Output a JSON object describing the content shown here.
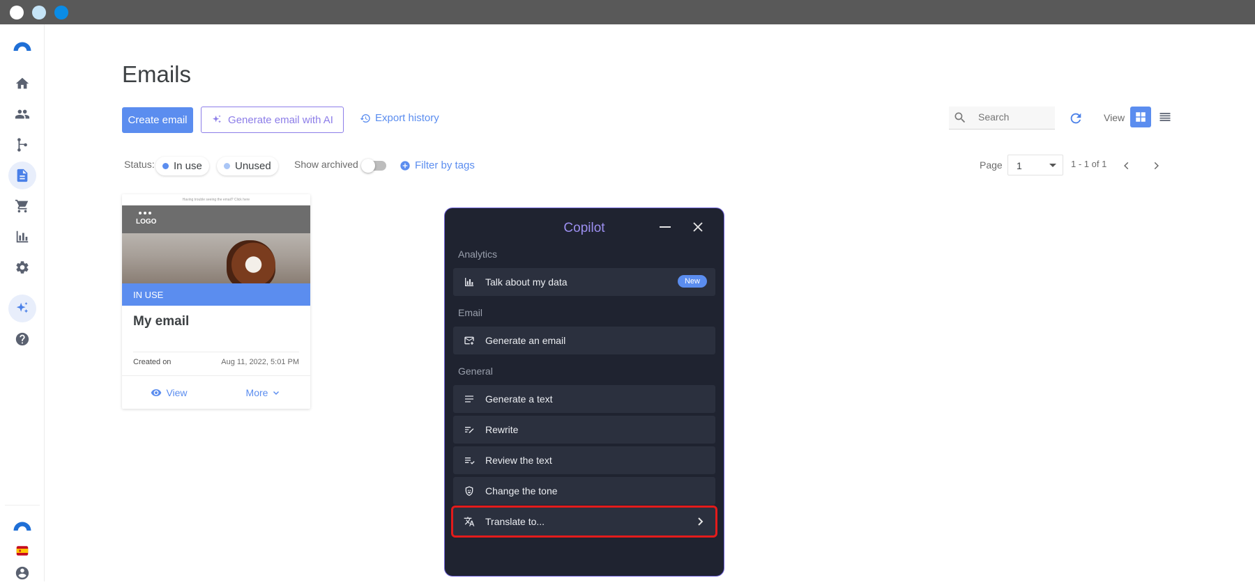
{
  "window": {
    "dots": [
      "#ffffff",
      "#c5e4f7",
      "#0a8ce6"
    ]
  },
  "sidebar": {
    "items": [
      {
        "icon": "home-icon"
      },
      {
        "icon": "contacts-icon"
      },
      {
        "icon": "automation-icon"
      },
      {
        "icon": "document-icon",
        "active": true
      },
      {
        "icon": "cart-icon"
      },
      {
        "icon": "analytics-icon"
      },
      {
        "icon": "settings-icon"
      },
      {
        "icon": "sparkles-icon",
        "active": true
      },
      {
        "icon": "help-icon"
      }
    ]
  },
  "page": {
    "title": "Emails",
    "toolbar": {
      "create_label": "Create email",
      "ai_label": "Generate email with AI",
      "export_label": "Export history",
      "search_placeholder": "Search",
      "view_label": "View"
    },
    "filters": {
      "status_label": "Status:",
      "chips": [
        {
          "label": "In use",
          "color": "#5b8def"
        },
        {
          "label": "Unused",
          "color": "#aac6f6"
        }
      ],
      "show_archived_label": "Show archived",
      "filter_tags_label": "Filter by tags"
    },
    "pagination": {
      "page_label": "Page",
      "page_value": "1",
      "range": "1 - 1 of 1"
    }
  },
  "card": {
    "preheader": "Having trouble seeing the email? Click here",
    "logo": "LOGO",
    "status": "IN USE",
    "name": "My email",
    "created_label": "Created on",
    "created_value": "Aug 11, 2022, 5:01 PM",
    "view_label": "View",
    "more_label": "More"
  },
  "copilot": {
    "title": "Copilot",
    "sections": [
      {
        "title": "Analytics",
        "items": [
          {
            "label": "Talk about my data",
            "icon": "chart-icon",
            "badge": "New"
          }
        ]
      },
      {
        "title": "Email",
        "items": [
          {
            "label": "Generate an email",
            "icon": "mail-icon"
          }
        ]
      },
      {
        "title": "General",
        "items": [
          {
            "label": "Generate a text",
            "icon": "text-lines-icon"
          },
          {
            "label": "Rewrite",
            "icon": "rewrite-icon"
          },
          {
            "label": "Review the text",
            "icon": "review-icon"
          },
          {
            "label": "Change the tone",
            "icon": "tone-icon"
          },
          {
            "label": "Translate to...",
            "icon": "translate-icon"
          }
        ]
      }
    ]
  }
}
